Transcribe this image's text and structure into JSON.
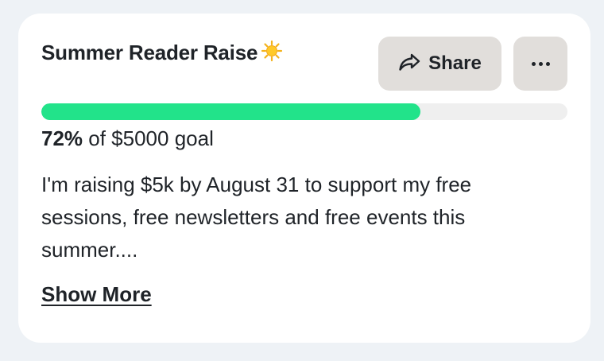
{
  "campaign": {
    "title": "Summer Reader Raise",
    "title_emoji_icon": "sun-icon",
    "progress_percent": 72,
    "progress_label": "72%",
    "goal_text": " of $5000 goal",
    "description": "I'm raising $5k by August 31 to support my free sessions, free newsletters and free events this summer....",
    "show_more_label": "Show More"
  },
  "actions": {
    "share_label": "Share",
    "share_icon": "share-arrow-icon",
    "more_icon": "more-dots-icon"
  },
  "colors": {
    "background": "#eef2f6",
    "card": "#ffffff",
    "button": "#e1dedb",
    "progress_fill": "#22e38a",
    "progress_track": "#efefef",
    "text": "#1f2328"
  }
}
